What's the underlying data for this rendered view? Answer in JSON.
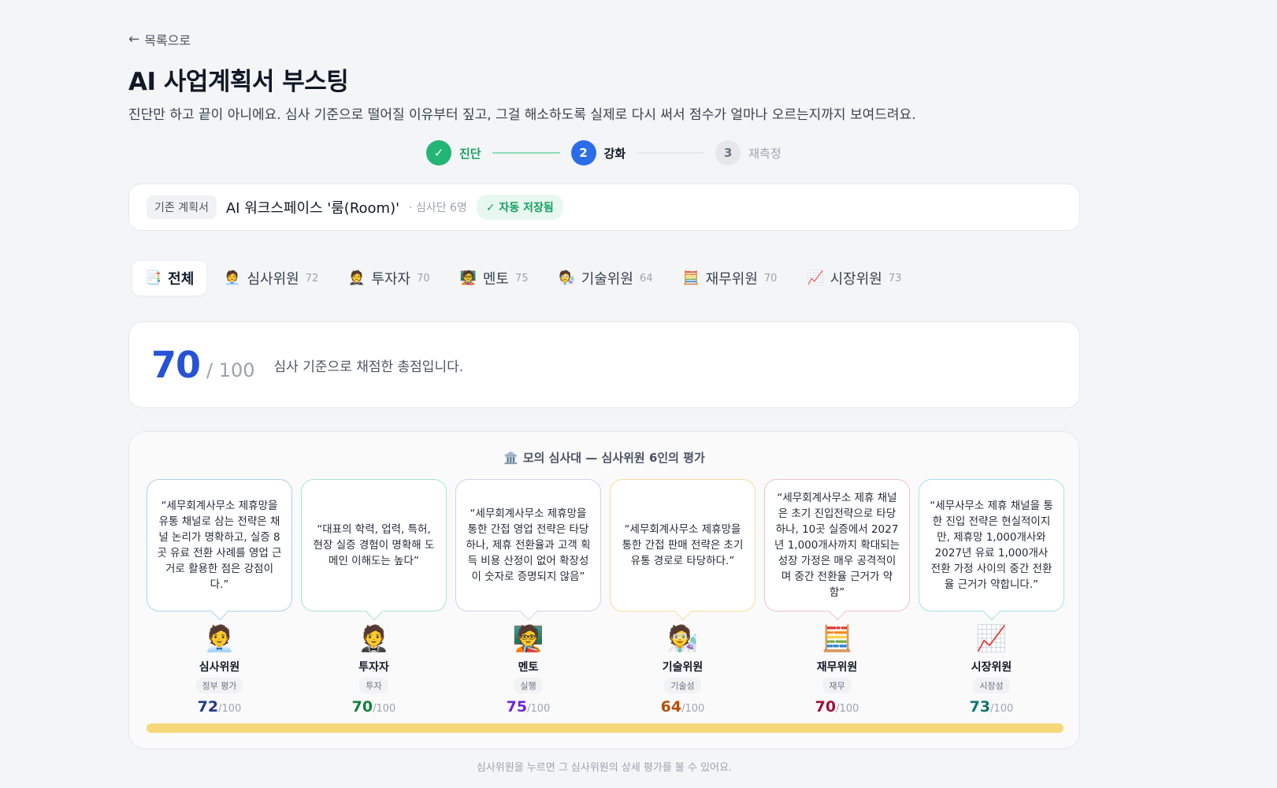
{
  "nav": {
    "back_label": "목록으로"
  },
  "header": {
    "title": "AI 사업계획서 부스팅",
    "description": "진단만 하고 끝이 아니에요. 심사 기준으로 떨어질 이유부터 짚고, 그걸 해소하도록 실제로 다시 써서 점수가 얼마나 오르는지까지 보여드려요."
  },
  "stepper": {
    "steps": [
      {
        "number": "✓",
        "label": "진단",
        "state": "done"
      },
      {
        "number": "2",
        "label": "강화",
        "state": "active"
      },
      {
        "number": "3",
        "label": "재측정",
        "state": "todo"
      }
    ]
  },
  "plan": {
    "tag": "기존 계획서",
    "name": "AI 워크스페이스 '룸(Room)'",
    "meta": "· 심사단 6명",
    "saved": "✓ 자동 저장됨"
  },
  "tabs": [
    {
      "emoji": "📑",
      "label": "전체",
      "score": "",
      "active": true
    },
    {
      "emoji": "🧑‍💼",
      "label": "심사위원",
      "score": "72",
      "active": false
    },
    {
      "emoji": "🤵",
      "label": "투자자",
      "score": "70",
      "active": false
    },
    {
      "emoji": "🧑‍🏫",
      "label": "멘토",
      "score": "75",
      "active": false
    },
    {
      "emoji": "🧑‍🔬",
      "label": "기술위원",
      "score": "64",
      "active": false
    },
    {
      "emoji": "🧮",
      "label": "재무위원",
      "score": "70",
      "active": false
    },
    {
      "emoji": "📈",
      "label": "시장위원",
      "score": "73",
      "active": false
    }
  ],
  "score": {
    "value": "70",
    "total": "/ 100",
    "description": "심사 기준으로 채점한 총점입니다."
  },
  "panel": {
    "emoji": "🏛️",
    "title": "모의 심사대 — 심사위원 6인의 평가",
    "progress": 1.0,
    "judges": [
      {
        "quote": "“세무회계사무소 제휴망을 유통 채널로 삼는 전략은 채널 논리가 명확하고, 실증 8곳 유료 전환 사례를 영업 근거로 활용한 점은 강점이다.”",
        "emoji": "🧑‍💼",
        "name": "심사위원",
        "role": "정부 평가",
        "score": "72",
        "den": "/100",
        "color": "#1e3a8a",
        "border": "#a9d3ec"
      },
      {
        "quote": "“대표의 학력, 업력, 특허, 현장 실증 경험이 명확해 도메인 이해도는 높다”",
        "emoji": "🤵",
        "name": "투자자",
        "role": "투자",
        "score": "70",
        "den": "/100",
        "color": "#15803d",
        "border": "#a8e3cf"
      },
      {
        "quote": "“세무회계사무소 제휴망을 통한 간접 영업 전략은 타당하나, 제휴 전환율과 고객 획득 비용 산정이 없어 확장성이 숫자로 증명되지 않음”",
        "emoji": "🧑‍🏫",
        "name": "멘토",
        "role": "실행",
        "score": "75",
        "den": "/100",
        "color": "#6d28d9",
        "border": "#d8cdf0"
      },
      {
        "quote": "“세무회계사무소 제휴망을 통한 간접 판매 전략은 초기 유통 경로로 타당하다.”",
        "emoji": "🧑‍🔬",
        "name": "기술위원",
        "role": "기술성",
        "score": "64",
        "den": "/100",
        "color": "#b45309",
        "border": "#f5dd9c"
      },
      {
        "quote": "“세무회계사무소 제휴 채널은 초기 진입전략으로 타당하나, 10곳 실증에서 2027년 1,000개사까지 확대되는 성장 가정은 매우 공격적이며 중간 전환율 근거가 약함”",
        "emoji": "🧮",
        "name": "재무위원",
        "role": "재무",
        "score": "70",
        "den": "/100",
        "color": "#9f1239",
        "border": "#f1c1cb"
      },
      {
        "quote": "“세무사무소 제휴 채널을 통한 진입 전략은 현실적이지만, 제휴망 1,000개사와 2027년 유료 1,000개사 전환 가정 사이의 중간 전환율 근거가 약합니다.”",
        "emoji": "📈",
        "name": "시장위원",
        "role": "시장성",
        "score": "73",
        "den": "/100",
        "color": "#0f766e",
        "border": "#a8e0e6"
      }
    ]
  },
  "footnote": "심사위원을 누르면 그 심사위원의 상세 평가를 볼 수 있어요."
}
